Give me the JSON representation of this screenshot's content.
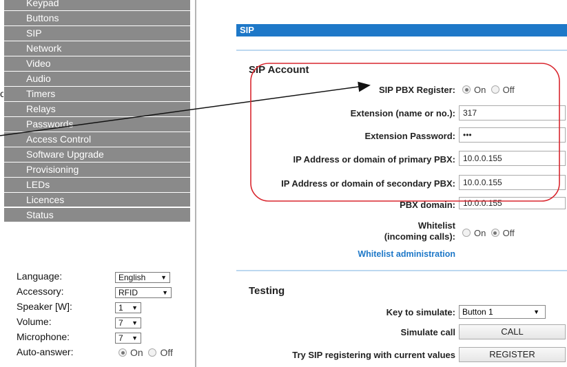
{
  "sidebar": {
    "menu": [
      "Keypad",
      "Buttons",
      "SIP",
      "Network",
      "Video",
      "Audio",
      "Timers",
      "Relays",
      "Passwords",
      "Access Control",
      "Software Upgrade",
      "Provisioning",
      "LEDs",
      "Licences",
      "Status"
    ],
    "settings": {
      "language": {
        "label": "Language:",
        "value": "English"
      },
      "accessory": {
        "label": "Accessory:",
        "value": "RFID"
      },
      "speaker": {
        "label": "Speaker [W]:",
        "value": "1"
      },
      "volume": {
        "label": "Volume:",
        "value": "7"
      },
      "microphone": {
        "label": "Microphone:",
        "value": "7"
      },
      "auto_answer": {
        "label": "Auto-answer:",
        "on": "On",
        "off": "Off",
        "selected": "On"
      }
    }
  },
  "cut_label": "o",
  "main": {
    "section_title": "SIP",
    "account": {
      "title": "SIP Account",
      "register_label": "SIP PBX Register:",
      "register_on": "On",
      "register_off": "Off",
      "register_selected": "On",
      "extension_label": "Extension (name or no.):",
      "extension_value": "317",
      "password_label": "Extension Password:",
      "password_value": "•••",
      "primary_label": "IP Address or domain of primary PBX:",
      "primary_value": "10.0.0.155",
      "secondary_label": "IP Address or domain of secondary PBX:",
      "secondary_value": "10.0.0.155",
      "domain_label": "PBX domain:",
      "domain_value": "10.0.0.155",
      "whitelist_label_1": "Whitelist",
      "whitelist_label_2": "(incoming calls):",
      "whitelist_on": "On",
      "whitelist_off": "Off",
      "whitelist_selected": "Off",
      "whitelist_link": "Whitelist administration"
    },
    "testing": {
      "title": "Testing",
      "key_label": "Key to simulate:",
      "key_value": "Button 1",
      "simulate_label": "Simulate call",
      "call_button": "CALL",
      "register_label": "Try SIP registering with current values",
      "register_button": "REGISTER"
    }
  },
  "colors": {
    "accent": "#1e78c8",
    "menu_bg": "#8a8a8a",
    "annotation": "#d9262e"
  }
}
